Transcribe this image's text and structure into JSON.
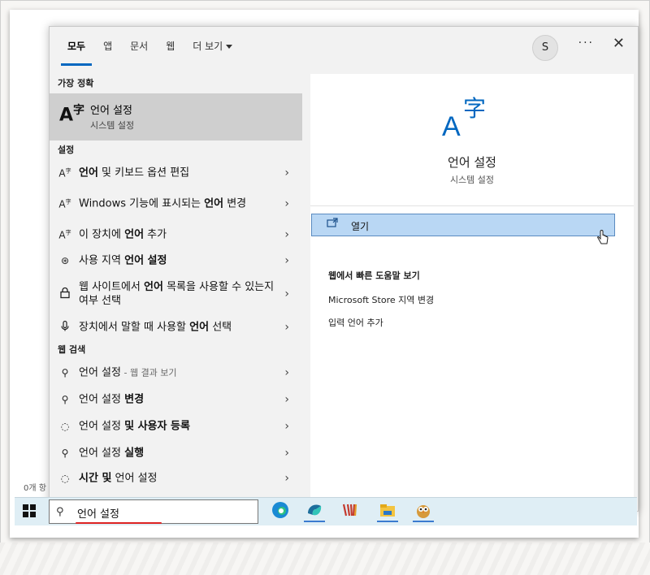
{
  "header": {
    "tabs": [
      "모두",
      "앱",
      "문서",
      "웹",
      "더 보기"
    ],
    "avatar": "S",
    "more": "···",
    "close": "✕"
  },
  "best_match": {
    "section": "가장 정확",
    "title": "언어 설정",
    "subtitle": "시스템 설정",
    "icon": "language-icon"
  },
  "settings": {
    "section": "설정",
    "items": [
      {
        "pre": "",
        "bold": "언어",
        "post": " 및 키보드 옵션 편집",
        "icon": "language-icon"
      },
      {
        "pre": "Windows 기능에 표시되는 ",
        "bold": "언어",
        "post": " 변경",
        "icon": "language-icon"
      },
      {
        "pre": "이 장치에 ",
        "bold": "언어",
        "post": " 추가",
        "icon": "language-icon"
      },
      {
        "pre": "사용 지역 ",
        "bold": "언어 설정",
        "post": "",
        "icon": "globe-icon"
      },
      {
        "pre": "웹 사이트에서 ",
        "bold": "언어",
        "post": " 목록을 사용할 수 있는지 여부 선택",
        "icon": "lock-icon"
      },
      {
        "pre": "장치에서 말할 때 사용할 ",
        "bold": "언어",
        "post": " 선택",
        "icon": "microphone-icon"
      }
    ]
  },
  "web": {
    "section": "웹 검색",
    "items": [
      {
        "pre": "언어 설정",
        "bold": "",
        "post": "",
        "sub": " - 웹 결과 보기",
        "icon": "search-icon"
      },
      {
        "pre": "언어 설정 ",
        "bold": "변경",
        "post": "",
        "sub": "",
        "icon": "search-icon"
      },
      {
        "pre": "언어 설정 ",
        "bold": "및 사용자 등록",
        "post": "",
        "sub": "",
        "icon": "chat-icon"
      },
      {
        "pre": "언어 설정 ",
        "bold": "실행",
        "post": "",
        "sub": "",
        "icon": "search-icon"
      },
      {
        "pre": "",
        "bold": "시간 및",
        "post": " 언어 설정",
        "sub": "",
        "icon": "chat-icon"
      }
    ]
  },
  "detail": {
    "title": "언어 설정",
    "subtitle": "시스템 설정",
    "open_label": "열기",
    "help_title": "웹에서 빠른 도움말 보기",
    "links": [
      "Microsoft Store 지역 변경",
      "입력 언어 추가"
    ]
  },
  "taskbar": {
    "search_value": "언어 설정",
    "apps": [
      "edge-icon",
      "app-icon",
      "chart-icon",
      "file-explorer-icon",
      "owl-app-icon"
    ]
  },
  "background_text": "0개 항"
}
